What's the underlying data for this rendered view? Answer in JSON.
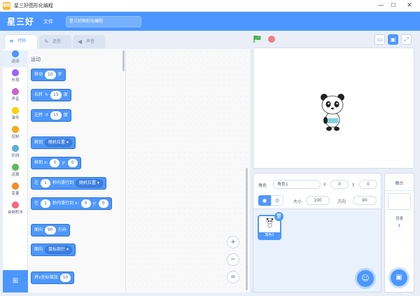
{
  "window": {
    "app_icon_text": "编程",
    "title": "星三好图形化编程",
    "min_glyph": "—",
    "max_glyph": "☐",
    "close_glyph": "✕"
  },
  "menubar": {
    "logo": "星三好",
    "file_menu": "文件",
    "project_title": "星三好图形化编程"
  },
  "tabs": [
    {
      "label": "代码",
      "icon": "code-icon",
      "glyph": "≡"
    },
    {
      "label": "造型",
      "icon": "brush-icon",
      "glyph": "✎"
    },
    {
      "label": "声音",
      "icon": "speaker-icon",
      "glyph": "◀"
    }
  ],
  "categories": [
    {
      "label": "运动",
      "color": "#4c97ff"
    },
    {
      "label": "外观",
      "color": "#9966ff"
    },
    {
      "label": "声音",
      "color": "#cf63cf"
    },
    {
      "label": "事件",
      "color": "#ffd500"
    },
    {
      "label": "控制",
      "color": "#ffab19"
    },
    {
      "label": "侦测",
      "color": "#5cb1d6"
    },
    {
      "label": "运算",
      "color": "#59c059"
    },
    {
      "label": "变量",
      "color": "#ff8c1a"
    },
    {
      "label": "自制积木",
      "color": "#ff6680"
    }
  ],
  "palette": {
    "heading": "运动",
    "blocks": {
      "move": {
        "pre": "移动",
        "value": "10",
        "post": "步"
      },
      "turn_right": {
        "pre": "右转",
        "value": "15",
        "post": "度"
      },
      "turn_left": {
        "pre": "左转",
        "value": "15",
        "post": "度"
      },
      "goto": {
        "pre": "移到",
        "option": "随机位置"
      },
      "goto_xy": {
        "pre": "移到 x:",
        "x": "0",
        "ymid": "y:",
        "y": "0"
      },
      "glide_to": {
        "pre": "在",
        "secs": "1",
        "mid": "秒内滑行到",
        "option": "随机位置"
      },
      "glide_xy": {
        "pre": "在",
        "secs": "1",
        "mid": "秒内滑行到 x:",
        "x": "0",
        "ymid": "y:",
        "y": "0"
      },
      "point_dir": {
        "pre": "面向",
        "value": "90",
        "post": "方向"
      },
      "point_towards": {
        "pre": "面向",
        "option": "鼠标指针"
      },
      "change_x": {
        "pre": "将x坐标增加",
        "value": "10"
      }
    }
  },
  "zoom": {
    "in": "+",
    "out": "−",
    "reset": "="
  },
  "sprite_info": {
    "sprite_label": "角色",
    "sprite_name": "角色1",
    "x_label": "x",
    "x_value": "0",
    "y_label": "y",
    "y_value": "0",
    "show_label": "显示",
    "size_label": "大小",
    "size_value": "100",
    "direction_label": "方向",
    "direction_value": "90"
  },
  "sprites": [
    {
      "name": "角色1"
    }
  ],
  "stage_panel": {
    "title": "舞台",
    "backdrop_label": "背景",
    "backdrop_count": "1"
  },
  "colors": {
    "accent": "#4c97ff",
    "motion_block": "#4c97ff",
    "stop": "#ec5959",
    "flag": "#4cbf56"
  }
}
